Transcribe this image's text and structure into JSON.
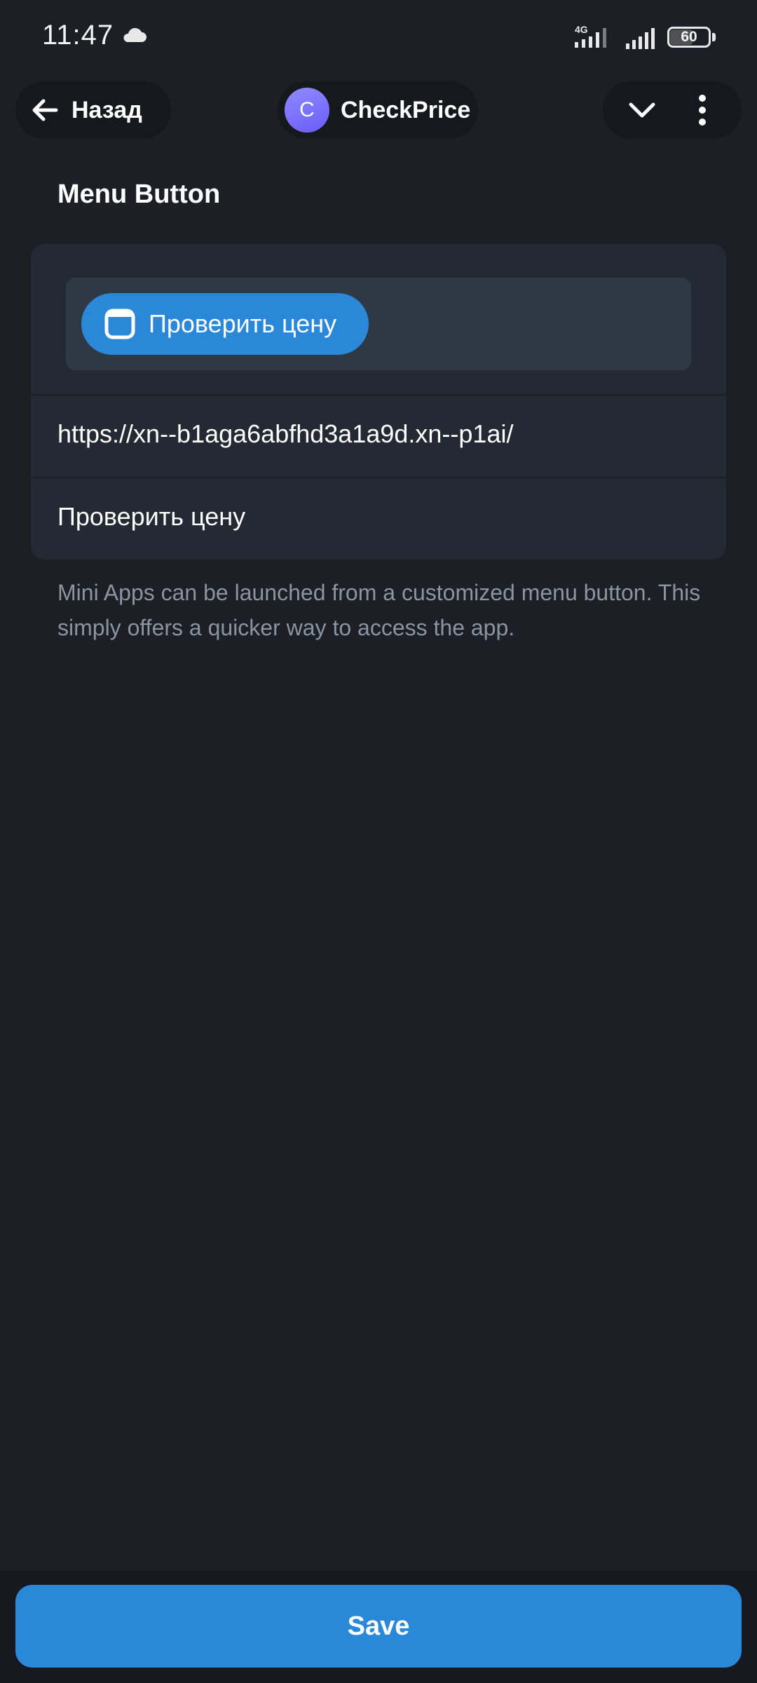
{
  "status_bar": {
    "time": "11:47",
    "network": "4G",
    "battery": "60",
    "battery_level": 0.6,
    "icons": [
      "cloud-icon",
      "signal-4g-icon",
      "signal-icon",
      "battery-icon"
    ]
  },
  "header": {
    "back_label": "Назад",
    "back_icon": "arrow-left-icon",
    "app_avatar_letter": "C",
    "app_name": "CheckPrice",
    "dropdown_icon": "chevron-down-icon",
    "more_icon": "more-vertical-icon"
  },
  "section": {
    "title": "Menu Button",
    "preview_button_label": "Проверить цену",
    "preview_icon": "webapp-icon",
    "url_value": "https://xn--b1aga6abfhd3a1a9d.xn--p1ai/",
    "text_value": "Проверить цену",
    "hint": "Mini Apps can be launched from a customized menu button. This simply offers a quicker way to access the app."
  },
  "footer": {
    "save_label": "Save"
  },
  "colors": {
    "background": "#1c1f26",
    "card": "#242a33",
    "accent": "#2b88d8",
    "hint_text": "#8a95a1"
  }
}
